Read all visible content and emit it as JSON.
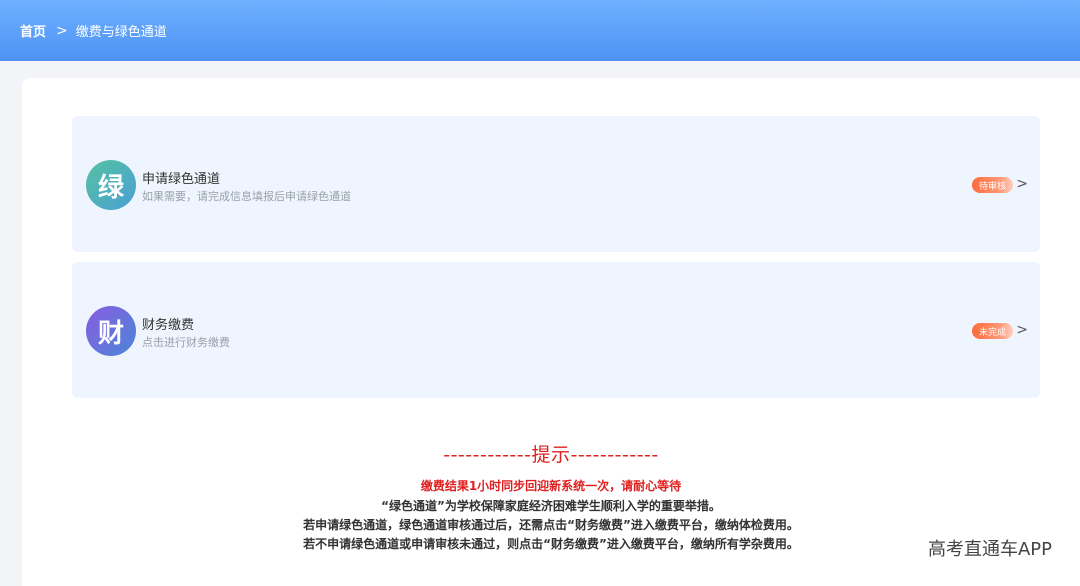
{
  "breadcrumb": {
    "home": "首页",
    "separator": ">",
    "current": "缴费与绿色通道"
  },
  "cards": [
    {
      "icon_char": "绿",
      "title": "申请绿色通道",
      "subtitle": "如果需要，请完成信息填报后申请绿色通道",
      "status": "待审核",
      "chevron": ">"
    },
    {
      "icon_char": "财",
      "title": "财务缴费",
      "subtitle": "点击进行财务缴费",
      "status": "未完成",
      "chevron": ">"
    }
  ],
  "tips": {
    "heading": "------------提示------------",
    "notice": "缴费结果1小时同步回迎新系统一次，请耐心等待",
    "lines": [
      "“绿色通道”为学校保障家庭经济困难学生顺利入学的重要举措。",
      "若申请绿色通道，绿色通道审核通过后，还需点击“财务缴费”进入缴费平台，缴纳体检费用。",
      "若不申请绿色通道或申请审核未通过，则点击“财务缴费”进入缴费平台，缴纳所有学杂费用。"
    ]
  },
  "watermark": "高考直通车APP",
  "colors": {
    "header_blue": "#4e93f5",
    "alert_red": "#e02020",
    "status_orange": "#ff6a3a"
  }
}
